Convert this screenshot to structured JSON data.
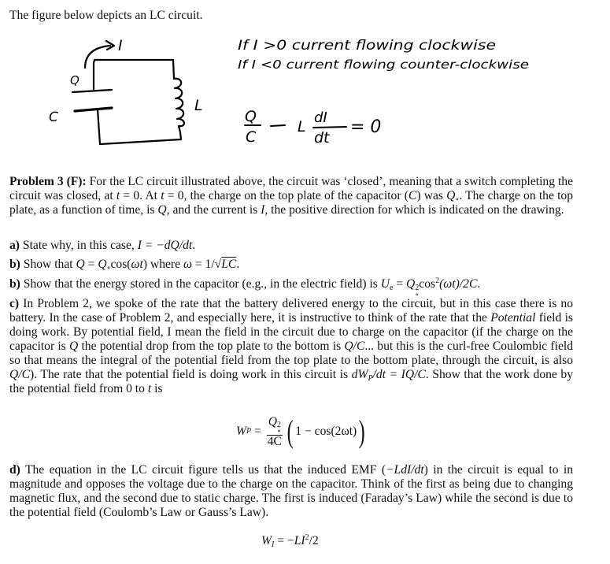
{
  "intro": "The figure below depicts an LC circuit.",
  "figure": {
    "labels": {
      "current": "I",
      "charge": "Q",
      "capacitor": "C",
      "inductor": "L"
    },
    "notes": [
      "If I >0 current flowing clockwise",
      "If I <0 current flowing counter-clockwise"
    ],
    "equation": {
      "num_left": "Q",
      "den_left": "C",
      "minus": "—",
      "coef": "L",
      "num_right": "dI",
      "den_right": "dt",
      "rhs": "= 0"
    }
  },
  "problem": {
    "label": "Problem 3 (F):",
    "text_1": " For the LC circuit illustrated above, the circuit was ‘closed’, meaning that a switch completing the circuit was closed, at ",
    "t": "t",
    "eq0": " = 0. At ",
    "eq0b": " = 0, the charge on the top plate of the capacitor (",
    "C": "C",
    "text_2": ") was ",
    "Qo": "Q",
    "o": "∘",
    "text_3": ". The charge on the top plate, as a function of time, is ",
    "Q": "Q",
    "text_4": ", and the current is ",
    "I": "I",
    "text_5": ", the positive direction for which is indicated on the drawing."
  },
  "parts": {
    "a": {
      "label": "a)",
      "text": " State why, in this case, ",
      "math": "I = −dQ/dt",
      "end": "."
    },
    "b1": {
      "label": "b)",
      "text": " Show that ",
      "math_1": "Q",
      "math_2": " = ",
      "math_3": "Q",
      "math_4": "cos(",
      "math_5": "ωt",
      "math_6": ") where ",
      "math_7": "ω",
      "math_8": " = 1/√",
      "math_9": "LC",
      "end": "."
    },
    "b2": {
      "label": "b)",
      "text": " Show that the energy stored in the capacitor (e.g., in the electric field) is ",
      "U": "U",
      "Ue_sub": "e",
      "eq": " = ",
      "Q": "Q",
      "sup2": "2",
      "cos": "cos",
      "wt": "(ωt)/2C",
      "end": "."
    },
    "c": {
      "label": "c)",
      "text_1": " In Problem 2, we spoke of the rate that the battery delivered energy to the circuit, but in this case there is no battery. In the case of Problem 2, and especially here, it is instructive to think of the rate that the ",
      "potential": "Potential",
      "text_2": " field is doing work. By potential field, I mean the field in the circuit due to charge on the capacitor (if the charge on the capacitor is ",
      "Q": "Q",
      "text_3": " the potential drop from the top plate to the bottom is ",
      "QC": "Q/C",
      "text_4": "... but this is the curl-free Coulombic field so that means the integral of the potential field from the top plate to the bottom plate, through the circuit, is also ",
      "QC2": "Q/C",
      "text_5": "). The rate that the potential field is doing work in this circuit is ",
      "dW": "dW",
      "P": "P",
      "dW_rest": "/dt = IQ/C",
      "text_6": ". Show that the work done by the potential field from 0 to ",
      "t": "t",
      "text_7": " is"
    },
    "wp_equation": {
      "lhs": "W",
      "lhs_sub": "P",
      "eq": " = ",
      "num": "Q",
      "num_sup": "2",
      "num_sub": "∘",
      "den": "4C",
      "paren_open": "(",
      "inside": "1 − cos(2ωt)",
      "paren_close": ")"
    },
    "d": {
      "label": "d)",
      "text_1": " The equation in the LC circuit figure tells us that the induced EMF (",
      "emf": "−LdI/dt",
      "text_2": ") in the circuit is equal to in magnitude and opposes the voltage due to the charge on the capacitor. Think of the first as being due to changing magnetic flux, and the second due to static charge. The first is induced (Faraday’s Law) while the second is due to the potential field (Coulomb’s Law or Gauss’s Law)."
    },
    "wi_equation": {
      "lhs": "W",
      "lhs_sub": "I",
      "eq": " = −",
      "LI": "LI",
      "sup": "2",
      "rest": "/2"
    }
  }
}
